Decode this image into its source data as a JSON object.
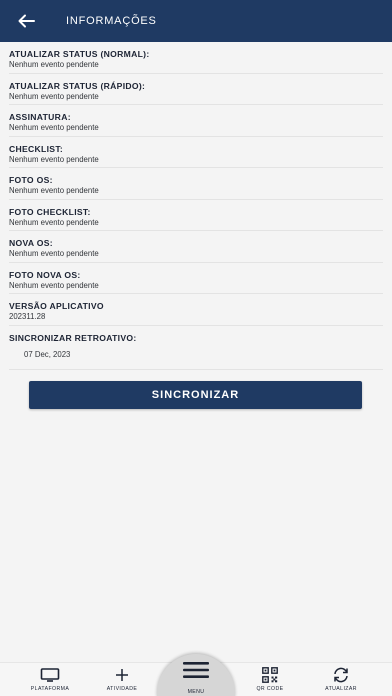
{
  "header": {
    "title": "INFORMAÇÕES",
    "back_icon": "arrow-left-icon"
  },
  "rows": [
    {
      "label": "ATUALIZAR STATUS (NORMAL):",
      "value": "Nenhum evento pendente"
    },
    {
      "label": "ATUALIZAR STATUS (RÁPIDO):",
      "value": "Nenhum evento pendente"
    },
    {
      "label": "ASSINATURA:",
      "value": "Nenhum evento pendente"
    },
    {
      "label": "CHECKLIST:",
      "value": "Nenhum evento pendente"
    },
    {
      "label": "FOTO OS:",
      "value": "Nenhum evento pendente"
    },
    {
      "label": "FOTO CHECKLIST:",
      "value": "Nenhum evento pendente"
    },
    {
      "label": "NOVA OS:",
      "value": "Nenhum evento pendente"
    },
    {
      "label": "FOTO NOVA OS:",
      "value": "Nenhum evento pendente"
    },
    {
      "label": "VERSÃO APLICATIVO",
      "value": "202311.28"
    }
  ],
  "retro": {
    "label": "SINCRONIZAR RETROATIVO:",
    "date": "07 Dec, 2023"
  },
  "sync_button": {
    "label": "SINCRONIZAR"
  },
  "bottom_nav": {
    "plataforma": {
      "label": "PLATAFORMA",
      "icon": "monitor-icon"
    },
    "atividade": {
      "label": "ATIVIDADE",
      "icon": "plus-icon"
    },
    "menu": {
      "label": "MENU",
      "icon": "hamburger-icon"
    },
    "qrcode": {
      "label": "QR CODE",
      "icon": "qr-code-icon"
    },
    "atualizar": {
      "label": "ATUALIZAR",
      "icon": "refresh-icon"
    }
  },
  "colors": {
    "primary": "#1f3a63",
    "background": "#f4f4f4"
  }
}
